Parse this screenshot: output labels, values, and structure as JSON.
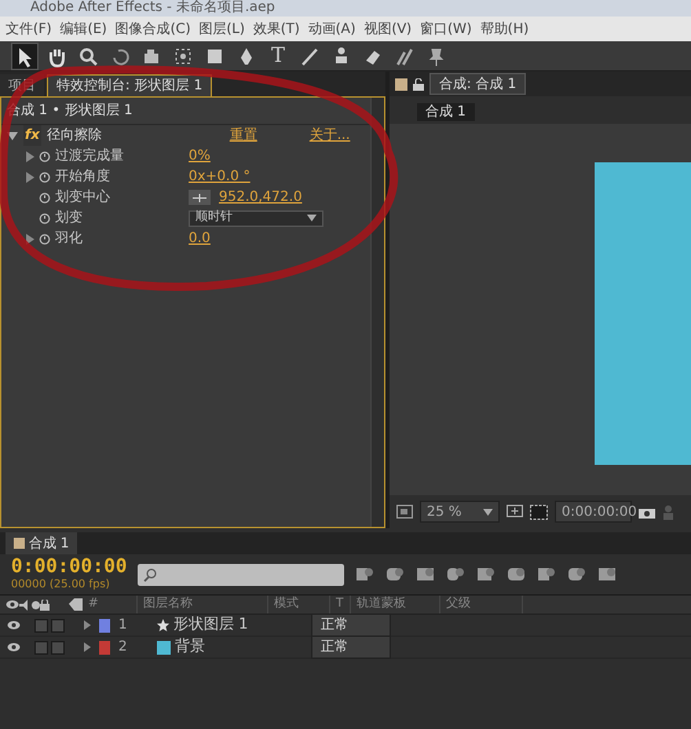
{
  "window": {
    "title": "Adobe After Effects - 未命名项目.aep"
  },
  "menu": [
    "文件(F)",
    "编辑(E)",
    "图像合成(C)",
    "图层(L)",
    "效果(T)",
    "动画(A)",
    "视图(V)",
    "窗口(W)",
    "帮助(H)"
  ],
  "tools": [
    {
      "kind": "select",
      "selected": true
    },
    {
      "kind": "hand",
      "selected": false
    },
    {
      "kind": "zoom",
      "selected": false
    },
    {
      "kind": "rotate",
      "selected": false
    },
    {
      "kind": "camera",
      "selected": false
    },
    {
      "kind": "pan",
      "selected": false
    },
    {
      "kind": "rect",
      "selected": false
    },
    {
      "kind": "pen",
      "selected": false
    },
    {
      "kind": "text",
      "selected": false,
      "label": "T"
    },
    {
      "kind": "brush",
      "selected": false
    },
    {
      "kind": "stamp",
      "selected": false
    },
    {
      "kind": "eraser",
      "selected": false
    },
    {
      "kind": "roto",
      "selected": false
    },
    {
      "kind": "pin",
      "selected": false
    }
  ],
  "effect_panel": {
    "tabs": [
      {
        "label": "项目",
        "selected": false
      },
      {
        "label": "特效控制台: 形状图层 1",
        "selected": true
      }
    ],
    "breadcrumb": "合成 1 • 形状图层 1",
    "effect": {
      "badge": "fx",
      "name": "径向擦除",
      "reset": "重置",
      "about": "关于..."
    },
    "properties": [
      {
        "name": "过渡完成量",
        "kind": "number",
        "value": "0%",
        "twirl": true
      },
      {
        "name": "开始角度",
        "kind": "number",
        "value": "0x+0.0 °",
        "twirl": true
      },
      {
        "name": "划变中心",
        "kind": "point",
        "value": "952.0,472.0",
        "twirl": false
      },
      {
        "name": "划变",
        "kind": "dropdown",
        "value": "顺时针",
        "twirl": false
      },
      {
        "name": "羽化",
        "kind": "number",
        "value": "0.0",
        "twirl": true
      }
    ]
  },
  "composition_panel": {
    "tab": "合成: 合成 1",
    "subtab": "合成 1",
    "zoom": "25 %",
    "time": "0:00:00:00"
  },
  "timeline": {
    "tab": "合成 1",
    "time": "0:00:00:00",
    "frames": "00000 (25.00 fps)",
    "columns": {
      "index": "#",
      "name": "图层名称",
      "mode": "模式",
      "t": "T",
      "matte": "轨道蒙板",
      "parent": "父级"
    },
    "layers": [
      {
        "index": "1",
        "name": "形状图层 1",
        "kind": "shape",
        "color": "#7080e0",
        "mode": "正常"
      },
      {
        "index": "2",
        "name": "背景",
        "kind": "solid",
        "color": "#c43a36",
        "source": {
          "color": "#4fb9d2"
        },
        "mode": "正常"
      }
    ]
  },
  "annotation": {
    "kind": "circle"
  }
}
